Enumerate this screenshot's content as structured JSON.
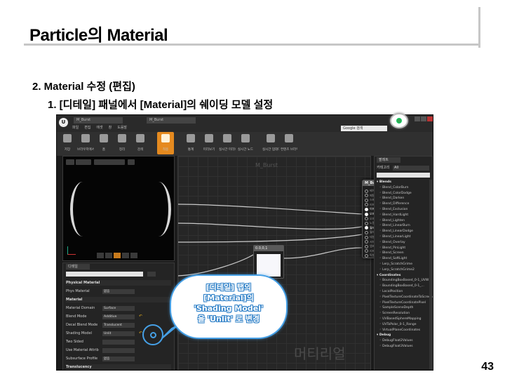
{
  "slide": {
    "title": "Particle의 Material",
    "bullet_1": "2. Material 수정 (편집)",
    "bullet_2": "1. [디테일] 패널에서 [Material]의 쉐이딩 모델 설정",
    "page_number": "43"
  },
  "editor": {
    "window_tabs": [
      "M_Burst",
      "M_Burst"
    ],
    "menu": [
      "파일",
      "편집",
      "에셋",
      "창",
      "도움말"
    ],
    "search_placeholder": "Google 검색",
    "toolbar": [
      {
        "label": "저장",
        "icon": "save-icon"
      },
      {
        "label": "브라우저에서 찾기",
        "icon": "find-icon"
      },
      {
        "label": "홈",
        "icon": "home-icon"
      },
      {
        "label": "정리",
        "icon": "clean-icon"
      },
      {
        "label": "검색",
        "icon": "search-icon"
      },
      {
        "label": "적용",
        "icon": "apply-icon",
        "active": true
      },
      {
        "label": "통계",
        "icon": "stats-icon"
      },
      {
        "label": "미리보기",
        "icon": "preview-icon"
      },
      {
        "label": "실시간 미리보기",
        "icon": "realtime-icon"
      },
      {
        "label": "실시간 노드",
        "icon": "live-nodes-icon"
      },
      {
        "label": "실시간 업데이트",
        "icon": "live-update-icon"
      },
      {
        "label": "컨텐츠 브라우저",
        "icon": "browser-icon"
      }
    ],
    "graph_title": "M_Burst",
    "graph_watermark": "머티리얼",
    "const_node_title": "0.0,0,1",
    "main_node": {
      "title": "M_Burst",
      "pins": [
        {
          "label": "베이스 컬러",
          "live": false
        },
        {
          "label": "메탈릭",
          "live": false
        },
        {
          "label": "스페큘러",
          "live": false
        },
        {
          "label": "러프니스",
          "live": false
        },
        {
          "label": "이미시브 컬러",
          "live": true
        },
        {
          "label": "오파시티",
          "live": true
        },
        {
          "label": "오파시티 마스크",
          "live": false
        },
        {
          "label": "노멀",
          "live": false
        },
        {
          "label": "월드 포지션 오프셋",
          "live": true
        },
        {
          "label": "월드 디스플레이스먼트",
          "live": false
        },
        {
          "label": "테셀레이션 멀티플라이어",
          "live": false
        },
        {
          "label": "서브서피스 컬러",
          "live": false
        },
        {
          "label": "앰비언트 오클루전",
          "live": false
        },
        {
          "label": "리프랙션",
          "live": false
        },
        {
          "label": "픽셀 깊이 오프셋",
          "live": false
        }
      ]
    },
    "details": {
      "tab_label": "디테일",
      "rows": [
        {
          "label": "Physical Material",
          "value": "",
          "head": true
        },
        {
          "label": "Phys Material",
          "value": "없음",
          "head": false
        },
        {
          "label": "Material",
          "value": "",
          "head": true
        },
        {
          "label": "Material Domain",
          "value": "Surface",
          "head": false
        },
        {
          "label": "Blend Mode",
          "value": "Additive",
          "head": false
        },
        {
          "label": "Decal Blend Mode",
          "value": "Translucent",
          "head": false
        },
        {
          "label": "Shading Model",
          "value": "Unlit",
          "head": false
        },
        {
          "label": "Two Sided",
          "value": "",
          "head": false
        },
        {
          "label": "Use Material Attrib",
          "value": "",
          "head": false
        },
        {
          "label": "Subsurface Profile",
          "value": "없음",
          "head": false
        },
        {
          "label": "Translucency",
          "value": "",
          "head": true
        }
      ]
    },
    "palette": {
      "tab_label": "팔레트",
      "category_label": "카테고리",
      "category_value": "All",
      "items": [
        {
          "label": "Blends",
          "group": true
        },
        {
          "label": "Blend_ColorBurn",
          "group": false
        },
        {
          "label": "Blend_ColorDodge",
          "group": false
        },
        {
          "label": "Blend_Darken",
          "group": false
        },
        {
          "label": "Blend_Difference",
          "group": false
        },
        {
          "label": "Blend_Exclusion",
          "group": false
        },
        {
          "label": "Blend_HardLight",
          "group": false
        },
        {
          "label": "Blend_Lighten",
          "group": false
        },
        {
          "label": "Blend_LinearBurn",
          "group": false
        },
        {
          "label": "Blend_LinearDodge",
          "group": false
        },
        {
          "label": "Blend_LinearLight",
          "group": false
        },
        {
          "label": "Blend_Overlay",
          "group": false
        },
        {
          "label": "Blend_PinLight",
          "group": false
        },
        {
          "label": "Blend_Screen",
          "group": false
        },
        {
          "label": "Blend_SoftLight",
          "group": false
        },
        {
          "label": "Lerp_ScratchGrime",
          "group": false
        },
        {
          "label": "Lerp_ScratchGrime2",
          "group": false
        },
        {
          "label": "Coordinates",
          "group": true
        },
        {
          "label": "BoundingBoxBased_0-1_UVW",
          "group": false
        },
        {
          "label": "BoundingBoxBased_0-1_...",
          "group": false
        },
        {
          "label": "LocalPosition",
          "group": false
        },
        {
          "label": "PixelTextureCoordinateToScreenUV",
          "group": false
        },
        {
          "label": "PixelTextureCoordinatePixel",
          "group": false
        },
        {
          "label": "SampleSceneDepth",
          "group": false
        },
        {
          "label": "ScreenResolution",
          "group": false
        },
        {
          "label": "UVBasedSphereMapping",
          "group": false
        },
        {
          "label": "UVToPolar_0-1_Range",
          "group": false
        },
        {
          "label": "VirtualPlaneCoordinates",
          "group": false
        },
        {
          "label": "Debug",
          "group": true
        },
        {
          "label": "DebugFloat2Values",
          "group": false
        },
        {
          "label": "DebugFloat3Values",
          "group": false
        }
      ]
    }
  },
  "callout": {
    "lines": [
      "[디테일] 탭의",
      "[Material]의",
      "'Shading Model'",
      "을 'Unlit' 로 변경"
    ]
  },
  "colors": {
    "accent_orange": "#e58a1f",
    "callout_blue": "#46a0e6"
  }
}
